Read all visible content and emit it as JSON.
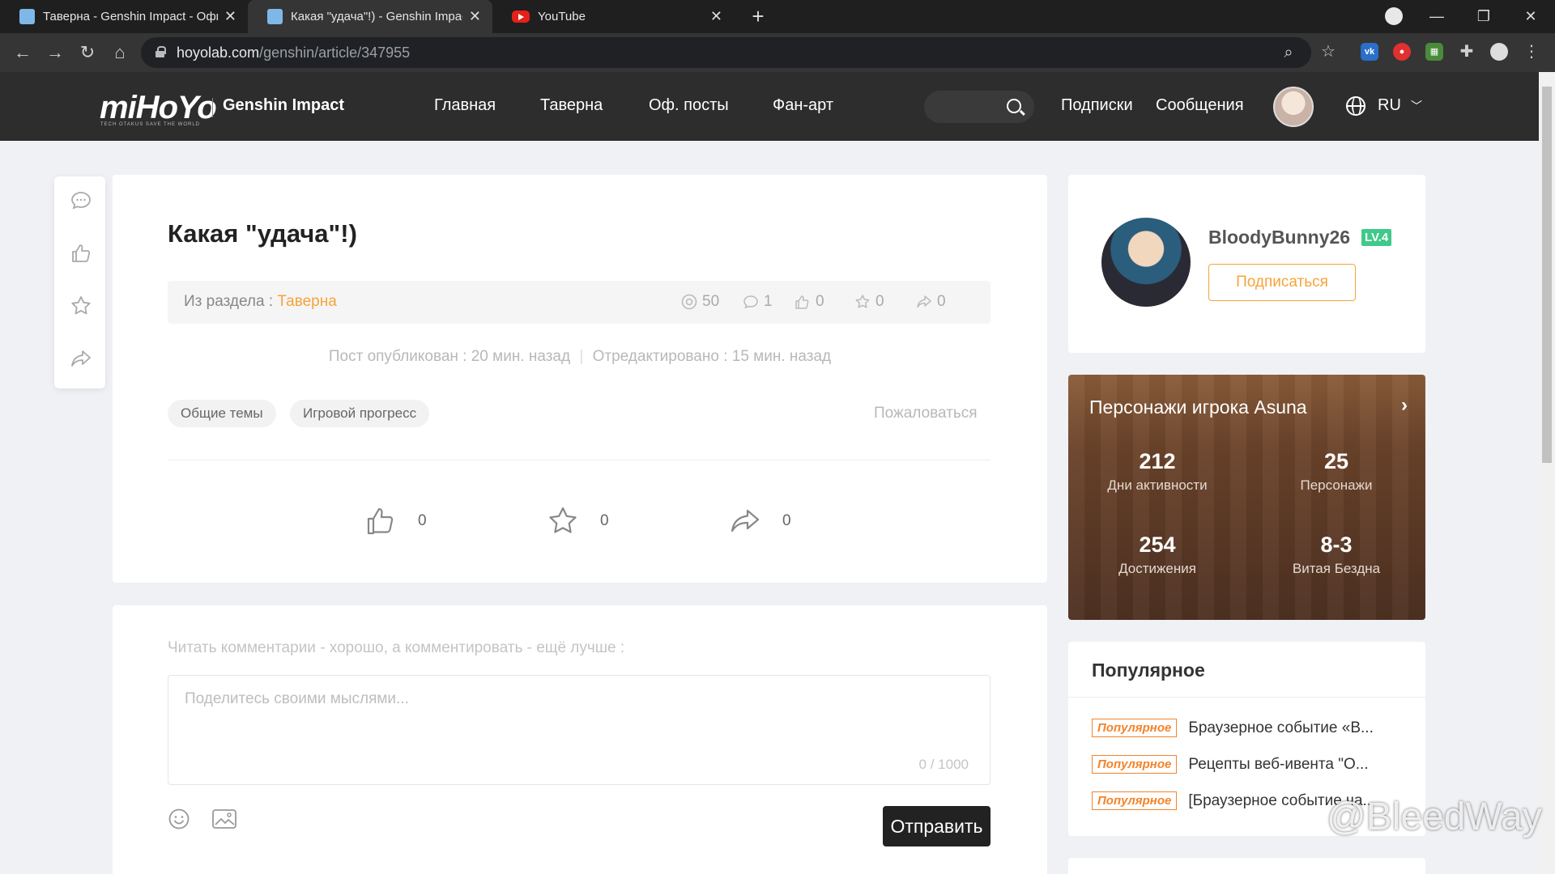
{
  "browser": {
    "tabs": [
      {
        "title": "Таверна - Genshin Impact - Офи"
      },
      {
        "title": "Какая \"удача\"!) - Genshin Impact"
      },
      {
        "title": "YouTube"
      }
    ],
    "url_host": "hoyolab.com",
    "url_path": "/genshin/article/347955"
  },
  "header": {
    "logo": "miHoYo",
    "logo_tagline": "TECH OTAKUS SAVE THE WORLD",
    "game": "Genshin Impact",
    "nav": [
      "Главная",
      "Таверна",
      "Оф. посты",
      "Фан-арт"
    ],
    "links": [
      "Подписки",
      "Сообщения"
    ],
    "lang": "RU"
  },
  "article": {
    "title": "Какая \"удача\"!)",
    "section_label": "Из раздела : ",
    "section_value": "Таверна",
    "stats": {
      "views": "50",
      "comments": "1",
      "likes": "0",
      "favorites": "0",
      "shares": "0"
    },
    "published": "Пост опубликован : 20 мин. назад",
    "edited": "Отредактировано : 15 мин. назад",
    "tags": [
      "Общие темы",
      "Игровой прогресс"
    ],
    "report": "Пожаловаться",
    "actions": {
      "likes": "0",
      "favorites": "0",
      "shares": "0"
    }
  },
  "comment": {
    "hint": "Читать комментарии - хорошо, а комментировать - ещё лучше :",
    "placeholder": "Поделитесь своими мыслями...",
    "counter": "0 / 1000",
    "send": "Отправить"
  },
  "profile": {
    "username": "BloodyBunny26",
    "level": "LV.4",
    "follow": "Подписаться"
  },
  "characters": {
    "title": "Персонажи игрока Asuna",
    "stats": [
      {
        "value": "212",
        "label": "Дни активности"
      },
      {
        "value": "25",
        "label": "Персонажи"
      },
      {
        "value": "254",
        "label": "Достижения"
      },
      {
        "value": "8-3",
        "label": "Витая Бездна"
      }
    ]
  },
  "popular": {
    "title": "Популярное",
    "items": [
      {
        "badge": "Популярное",
        "text": "Браузерное событие «В..."
      },
      {
        "badge": "Популярное",
        "text": "Рецепты веб-ивента \"О..."
      },
      {
        "badge": "Популярное",
        "text": "[Браузерное событие ча..."
      }
    ]
  },
  "watermark": "@BleedWay"
}
